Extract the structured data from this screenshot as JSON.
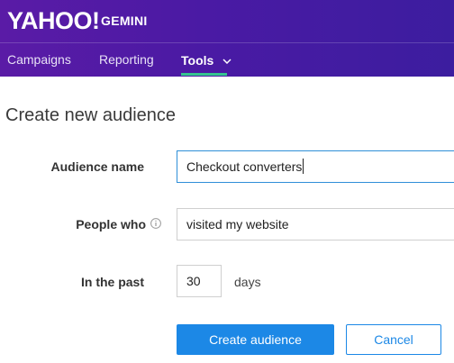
{
  "header": {
    "logo": "YAHOO!",
    "product": "GEMINI",
    "brand_color": "#4a1aa4"
  },
  "nav": {
    "items": [
      {
        "label": "Campaigns"
      },
      {
        "label": "Reporting"
      },
      {
        "label": "Tools",
        "active": true,
        "dropdown": true
      }
    ],
    "active_underline_color": "#35c48f"
  },
  "page": {
    "title": "Create new audience"
  },
  "form": {
    "audience_name": {
      "label": "Audience name",
      "value": "Checkout converters"
    },
    "people_who": {
      "label": "People who",
      "value": "visited my website",
      "info_icon": "info-icon"
    },
    "in_the_past": {
      "label": "In the past",
      "value": "30",
      "unit": "days"
    }
  },
  "actions": {
    "create_label": "Create audience",
    "cancel_label": "Cancel",
    "primary_color": "#1c88e6"
  }
}
